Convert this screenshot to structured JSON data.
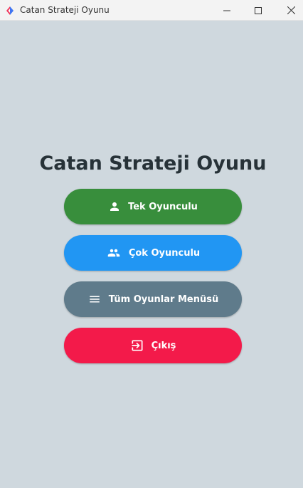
{
  "window": {
    "title": "Catan Strateji Oyunu",
    "controls": [
      "minimize-icon",
      "maximize-icon",
      "close-icon"
    ]
  },
  "main": {
    "heading": "Catan Strateji Oyunu",
    "buttons": [
      {
        "label": "Tek Oyunculu",
        "icon": "person-icon",
        "color": "#388e3c"
      },
      {
        "label": "Çok Oyunculu",
        "icon": "people-icon",
        "color": "#2196f3"
      },
      {
        "label": "Tüm Oyunlar Menüsü",
        "icon": "menu-icon",
        "color": "#5f7b8b"
      },
      {
        "label": "Çıkış",
        "icon": "exit-icon",
        "color": "#f31a4a"
      }
    ]
  },
  "colors": {
    "background": "#cfd8de",
    "heading": "#273238",
    "titlebar": "#f3f3f3"
  }
}
